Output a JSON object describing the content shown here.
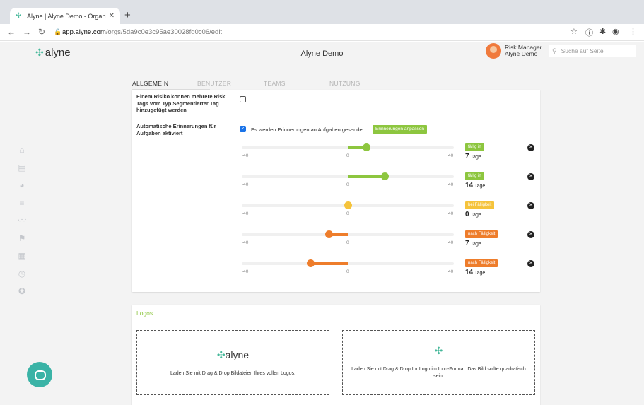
{
  "browser": {
    "tab_title": "Alyne | Alyne Demo - Organisa",
    "url_domain": "app.alyne.com",
    "url_path": "/orgs/5da9c0e3c95ae30028fd0c06/edit"
  },
  "header": {
    "app_title": "Alyne Demo",
    "logo_text": "alyne",
    "user_role": "Risk Manager",
    "user_org": "Alyne Demo",
    "search_placeholder": "Suche auf Seite"
  },
  "tabs": [
    "ALLGEMEIN",
    "BENUTZER",
    "TEAMS",
    "NUTZUNG"
  ],
  "settings": {
    "risk_tags_label": "Einem Risiko können mehrere Risk Tags vom Typ Segmentierter Tag hinzugefügt werden",
    "risk_tags_checked": false,
    "reminders_label": "Automatische Erinnerungen für Aufgaben aktiviert",
    "reminders_checked": true,
    "reminders_text": "Es werden Erinnerungen an Aufgaben gesendet",
    "adjust_button": "Erinnerungen anpassen"
  },
  "reminders": [
    {
      "value": 7,
      "badge": "fällig in",
      "days": "7",
      "unit": "Tage",
      "color": "#8dc63f"
    },
    {
      "value": 14,
      "badge": "fällig in",
      "days": "14",
      "unit": "Tage",
      "color": "#8dc63f"
    },
    {
      "value": 0,
      "badge": "bei Fälligkeit",
      "days": "0",
      "unit": "Tage",
      "color": "#f5c33b"
    },
    {
      "value": -7,
      "badge": "nach Fälligkeit",
      "days": "7",
      "unit": "Tage",
      "color": "#ee7d2b"
    },
    {
      "value": -14,
      "badge": "nach Fälligkeit",
      "days": "14",
      "unit": "Tage",
      "color": "#ee7d2b"
    }
  ],
  "slider_ticks": {
    "min": "-40",
    "mid": "0",
    "max": "40"
  },
  "logos": {
    "title": "Logos",
    "full_logo_text": "alyne",
    "full_logo_hint": "Laden Sie mit Drag & Drop Bildateien Ihres vollen Logos.",
    "icon_logo_hint": "Laden Sie mit Drag & Drop Ihr Logo im Icon-Format. Das Bild sollte quadratisch sein."
  }
}
